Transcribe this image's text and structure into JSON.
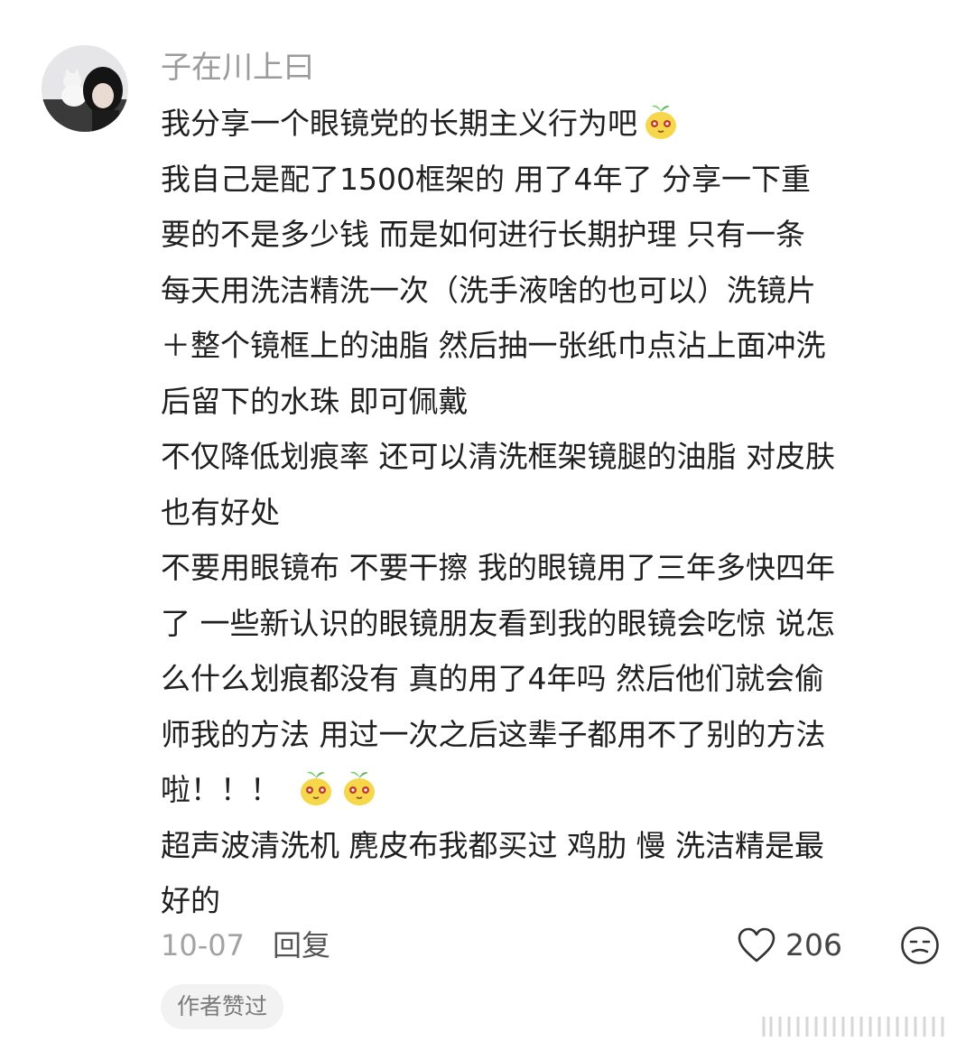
{
  "comment": {
    "username": "子在川上曰",
    "lines": [
      "我分享一个眼镜党的长期主义行为吧",
      "我自己是配了1500框架的 用了4年了 分享一下重",
      "要的不是多少钱 而是如何进行长期护理 只有一条",
      "每天用洗洁精洗一次（洗手液啥的也可以）洗镜片",
      "＋整个镜框上的油脂 然后抽一张纸巾点沾上面冲洗",
      "后留下的水珠 即可佩戴",
      "不仅降低划痕率 还可以清洗框架镜腿的油脂 对皮肤",
      "也有好处",
      "不要用眼镜布 不要干擦 我的眼镜用了三年多快四年",
      "了 一些新认识的眼镜朋友看到我的眼镜会吃惊 说怎",
      "么什么划痕都没有 真的用了4年吗 然后他们就会偷",
      "师我的方法 用过一次之后这辈子都用不了别的方法",
      "啦！！！",
      "超声波清洗机 麂皮布我都买过 鸡肋 慢 洗洁精是最",
      "好的"
    ],
    "emoji_name": "sprout-face-emoji",
    "date": "10-07",
    "reply_label": "回复",
    "like_count": "206",
    "author_liked_badge": "作者赞过"
  },
  "colors": {
    "username": "#9b9b9b",
    "text": "#1f1f1f",
    "meta": "#a3a3a3",
    "badge_bg": "#f2f2f2",
    "emoji_face": "#f6d64a"
  }
}
